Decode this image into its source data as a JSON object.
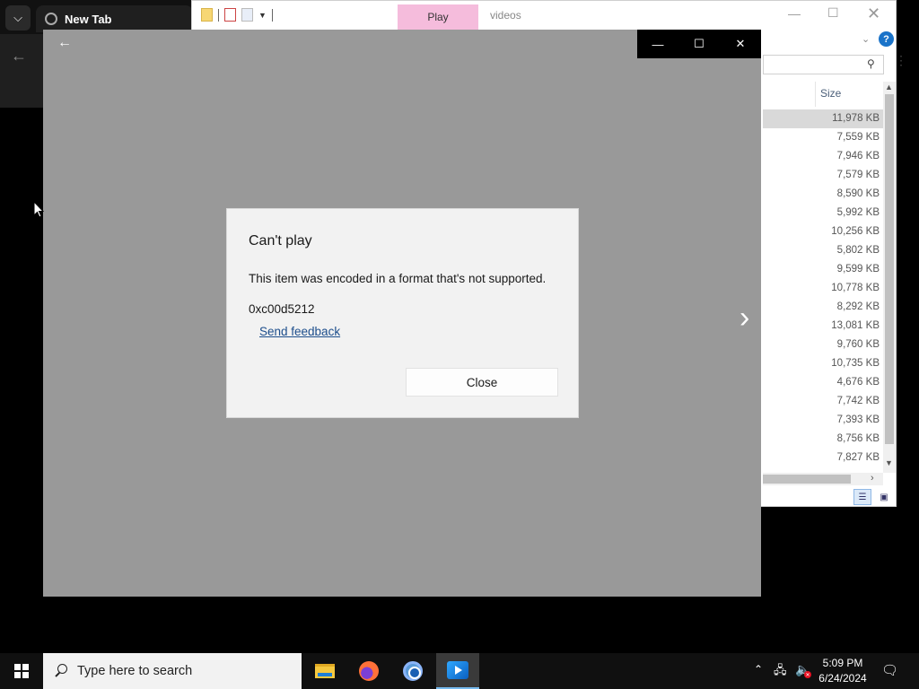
{
  "browser": {
    "tab_title": "New Tab"
  },
  "explorer": {
    "play_tab": "Play",
    "title": "videos",
    "column_header": "Size",
    "sizes": [
      "11,978 KB",
      "7,559 KB",
      "7,946 KB",
      "7,579 KB",
      "8,590 KB",
      "5,992 KB",
      "10,256 KB",
      "5,802 KB",
      "9,599 KB",
      "10,778 KB",
      "8,292 KB",
      "13,081 KB",
      "9,760 KB",
      "10,735 KB",
      "4,676 KB",
      "7,742 KB",
      "7,393 KB",
      "8,756 KB",
      "7,827 KB"
    ],
    "help_label": "?"
  },
  "dialog": {
    "title": "Can't play",
    "message": "This item was encoded in a format that's not supported.",
    "error_code": "0xc00d5212",
    "feedback_link": "Send feedback",
    "close_button": "Close"
  },
  "taskbar": {
    "search_placeholder": "Type here to search",
    "time": "5:09 PM",
    "date": "6/24/2024"
  },
  "colors": {
    "player_bg": "#999999",
    "dialog_bg": "#f2f2f2",
    "link": "#1d4e8c",
    "play_tab": "#f5bcdc",
    "taskbar": "#101010"
  }
}
